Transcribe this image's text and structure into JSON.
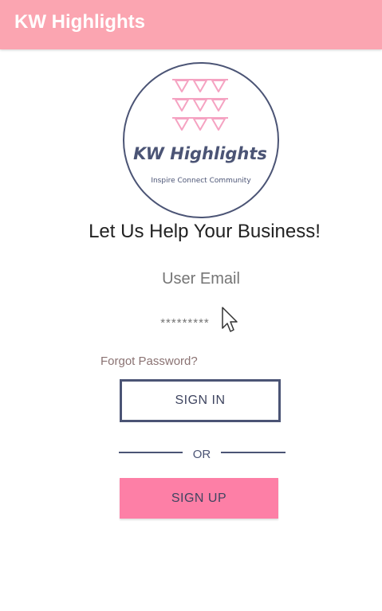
{
  "appbar": {
    "title": "KW Highlights"
  },
  "logo": {
    "name": "KW Highlights",
    "tagline": "Inspire Connect Community"
  },
  "headline": "Let Us Help Your Business!",
  "form": {
    "email_placeholder": "User Email",
    "password_placeholder": "*********",
    "forgot_label": "Forgot Password?",
    "signin_label": "SIGN IN",
    "divider_label": "OR",
    "signup_label": "SIGN UP"
  },
  "colors": {
    "appbar": "#fba5b1",
    "navy": "#4b5475",
    "pink_button": "#fd7fa6",
    "bunting": "#f5a3c2"
  }
}
